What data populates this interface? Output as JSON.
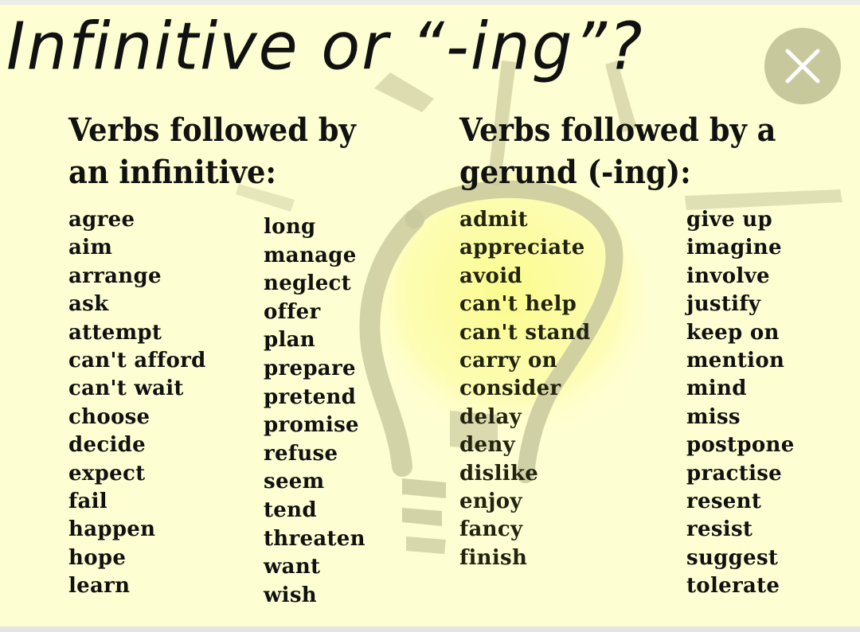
{
  "title": "Infinitive or “-ing”?",
  "close_button": {
    "icon": "close-icon",
    "label": "×"
  },
  "colors": {
    "background": "#fefed3",
    "bulb_shadow": "#c8c89d",
    "bulb_glow": "#fbfb9a",
    "text": "#111111",
    "close_button_bg": "#c8c89d"
  },
  "infinitive": {
    "heading_line1": "Verbs followed by",
    "heading_line2": "an infinitive:",
    "column1": [
      "agree",
      "aim",
      "arrange",
      "ask",
      "attempt",
      "can't afford",
      "can't wait",
      "choose",
      "decide",
      "expect",
      "fail",
      "happen",
      "hope",
      "learn"
    ],
    "column2": [
      "long",
      "manage",
      "neglect",
      "offer",
      "plan",
      "prepare",
      "pretend",
      "promise",
      "refuse",
      "seem",
      "tend",
      "threaten",
      "want",
      "wish"
    ]
  },
  "gerund": {
    "heading_line1": "Verbs followed by a",
    "heading_line2": "gerund (-ing):",
    "column1": [
      "admit",
      "appreciate",
      "avoid",
      "can't help",
      "can't stand",
      "carry on",
      "consider",
      "delay",
      "deny",
      "dislike",
      "enjoy",
      "fancy",
      "finish"
    ],
    "column2": [
      "give up",
      "imagine",
      "involve",
      "justify",
      "keep on",
      "mention",
      "mind",
      "miss",
      "postpone",
      "practise",
      "resent",
      "resist",
      "suggest",
      "tolerate"
    ]
  }
}
